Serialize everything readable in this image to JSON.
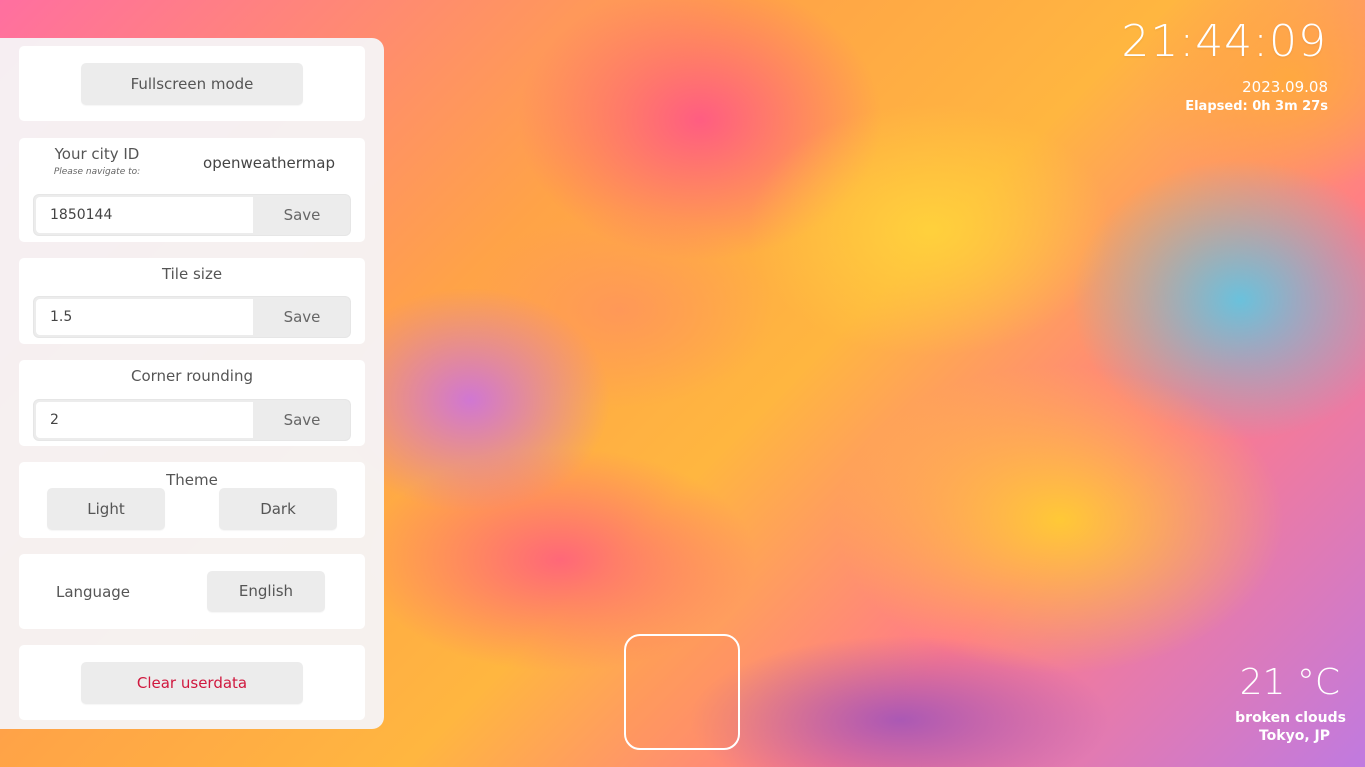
{
  "settings": {
    "fullscreen_label": "Fullscreen mode",
    "city": {
      "title": "Your city ID",
      "hint": "Please navigate to:",
      "provider": "openweathermap",
      "value": "1850144",
      "save_label": "Save"
    },
    "tile_size": {
      "title": "Tile size",
      "value": "1.5",
      "save_label": "Save"
    },
    "corner_rounding": {
      "title": "Corner rounding",
      "value": "2",
      "save_label": "Save"
    },
    "theme": {
      "title": "Theme",
      "light_label": "Light",
      "dark_label": "Dark"
    },
    "language": {
      "title": "Language",
      "value": "English"
    },
    "clear_label": "Clear userdata"
  },
  "clock": {
    "time": "21:44:09",
    "date": "2023.09.08",
    "elapsed": "Elapsed: 0h 3m 27s"
  },
  "weather": {
    "temperature": "21 °C",
    "description": "broken clouds",
    "location": "Tokyo, JP"
  },
  "colors": {
    "clear_text": "#d0183e",
    "panel_bg": "#f6f4f6",
    "button_bg": "#ececec"
  }
}
